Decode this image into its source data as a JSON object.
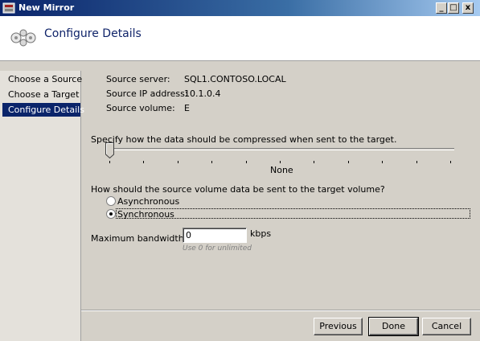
{
  "window": {
    "title": "New Mirror",
    "controls": [
      "_",
      "□",
      "x"
    ]
  },
  "header": {
    "title": "Configure Details"
  },
  "sidebar": {
    "items": [
      {
        "label": "Choose a Source"
      },
      {
        "label": "Choose a Target"
      },
      {
        "label": "Configure Details",
        "active": true
      }
    ]
  },
  "source": {
    "server_label": "Source server:",
    "server_value": "SQL1.CONTOSO.LOCAL",
    "ip_label": "Source IP address:",
    "ip_value": "10.1.0.4",
    "volume_label": "Source volume:",
    "volume_value": "E"
  },
  "compression": {
    "prompt": "Specify how the data should be compressed when sent to the target.",
    "value_label": "None",
    "level": 0
  },
  "transfer": {
    "prompt": "How should the source volume data be sent to the target volume?",
    "options": [
      {
        "label": "Asynchronous",
        "selected": false
      },
      {
        "label": "Synchronous",
        "selected": true
      }
    ]
  },
  "bandwidth": {
    "label": "Maximum bandwidth:",
    "value": "0",
    "unit": "kbps",
    "hint": "Use 0 for unlimited"
  },
  "buttons": {
    "previous": "Previous",
    "done": "Done",
    "cancel": "Cancel"
  },
  "colors": {
    "title_bar": "#0a246a",
    "selection": "#0a246a",
    "header_title": "#10246a"
  }
}
